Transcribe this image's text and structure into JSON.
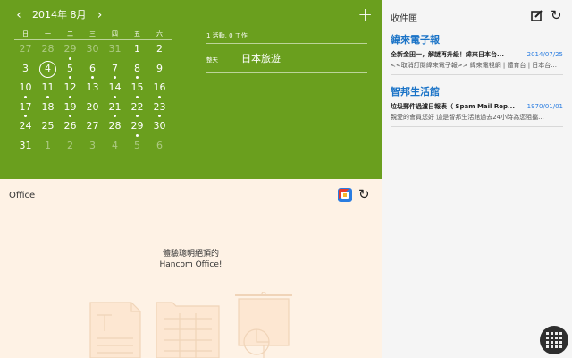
{
  "calendar": {
    "month_label": "2014年 8月",
    "prev_icon": "‹",
    "next_icon": "›",
    "add_icon": "+",
    "weekdays": [
      "日",
      "一",
      "二",
      "三",
      "四",
      "五",
      "六"
    ],
    "weeks": [
      [
        {
          "d": "27",
          "o": true
        },
        {
          "d": "28",
          "o": true
        },
        {
          "d": "29",
          "o": true,
          "e": true
        },
        {
          "d": "30",
          "o": true
        },
        {
          "d": "31",
          "o": true
        },
        {
          "d": "1"
        },
        {
          "d": "2"
        }
      ],
      [
        {
          "d": "3"
        },
        {
          "d": "4",
          "t": true
        },
        {
          "d": "5",
          "e": true
        },
        {
          "d": "6",
          "e": true
        },
        {
          "d": "7",
          "e": true
        },
        {
          "d": "8",
          "e": true
        },
        {
          "d": "9"
        }
      ],
      [
        {
          "d": "10",
          "e": true
        },
        {
          "d": "11",
          "e": true
        },
        {
          "d": "12",
          "e": true
        },
        {
          "d": "13"
        },
        {
          "d": "14",
          "e": true
        },
        {
          "d": "15",
          "e": true
        },
        {
          "d": "16",
          "e": true
        }
      ],
      [
        {
          "d": "17",
          "e": true
        },
        {
          "d": "18"
        },
        {
          "d": "19",
          "e": true
        },
        {
          "d": "20"
        },
        {
          "d": "21",
          "e": true
        },
        {
          "d": "22",
          "e": true
        },
        {
          "d": "23",
          "e": true
        }
      ],
      [
        {
          "d": "24"
        },
        {
          "d": "25"
        },
        {
          "d": "26"
        },
        {
          "d": "27"
        },
        {
          "d": "28"
        },
        {
          "d": "29",
          "e": true
        },
        {
          "d": "30"
        }
      ],
      [
        {
          "d": "31"
        },
        {
          "d": "1",
          "o": true
        },
        {
          "d": "2",
          "o": true
        },
        {
          "d": "3",
          "o": true
        },
        {
          "d": "4",
          "o": true
        },
        {
          "d": "5",
          "o": true
        },
        {
          "d": "6",
          "o": true
        }
      ]
    ],
    "summary": "1 活動, 0 工作",
    "event": {
      "day": "整天",
      "title": "日本旅遊"
    }
  },
  "office": {
    "title": "Office",
    "line1": "體驗聰明絕頂的",
    "line2": "Hancom Office!",
    "refresh_icon": "↻"
  },
  "mail": {
    "title": "收件匣",
    "refresh_icon": "↻",
    "items": [
      {
        "sender": "緯來電子報",
        "subject": "全新金田一，解謎再升級！緯來日本台...",
        "date": "2014/07/25",
        "preview": "<<取消訂閱緯來電子報>> 緯來電視網 | 體育台 | 日本台..."
      },
      {
        "sender": "智邦生活館",
        "subject": "垃圾郵件過濾日報表（ Spam Mail Rep...",
        "date": "1970/01/01",
        "preview": "親愛的會員您好 這是智邦生活館過去24小時為您阻擋..."
      }
    ]
  },
  "colors": {
    "calendar_bg": "#6a9f1e",
    "office_bg": "#fef2e5",
    "mail_bg": "#f5f5f5",
    "link": "#1a73c7"
  }
}
